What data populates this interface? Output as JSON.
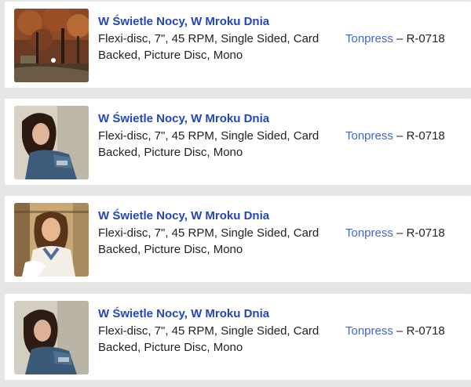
{
  "releases": [
    {
      "title": "W Świetle Nocy, W Mroku Dnia",
      "format": "Flexi-disc, 7\", 45 RPM, Single Sided, Card Backed, Picture Disc, Mono",
      "label": "Tonpress",
      "separator": "–",
      "catno": "R-0718",
      "thumbnail": "autumn-park-photo"
    },
    {
      "title": "W Świetle Nocy, W Mroku Dnia",
      "format": "Flexi-disc, 7\", 45 RPM, Single Sided, Card Backed, Picture Disc, Mono",
      "label": "Tonpress",
      "separator": "–",
      "catno": "R-0718",
      "thumbnail": "woman-portrait-photo"
    },
    {
      "title": "W Świetle Nocy, W Mroku Dnia",
      "format": "Flexi-disc, 7\", 45 RPM, Single Sided, Card Backed, Picture Disc, Mono",
      "label": "Tonpress",
      "separator": "–",
      "catno": "R-0718",
      "thumbnail": "woman-portrait-photo"
    },
    {
      "title": "W Świetle Nocy, W Mroku Dnia",
      "format": "Flexi-disc, 7\", 45 RPM, Single Sided, Card Backed, Picture Disc, Mono",
      "label": "Tonpress",
      "separator": "–",
      "catno": "R-0718",
      "thumbnail": "woman-portrait-photo"
    }
  ],
  "colors": {
    "title": "#2247b8",
    "link": "#3f66c9",
    "text": "#222222",
    "page_background": "#e6e6e6",
    "card_background": "#ffffff"
  }
}
